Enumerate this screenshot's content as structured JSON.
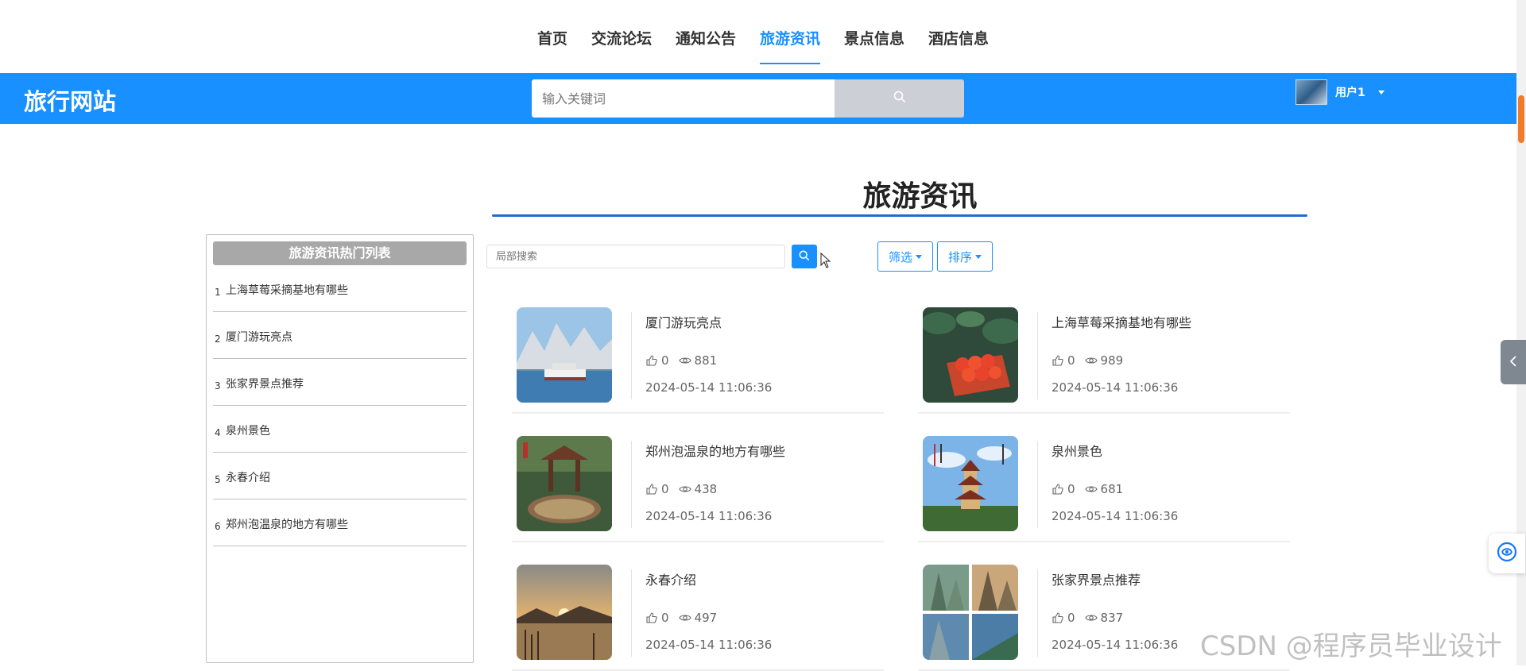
{
  "nav": {
    "items": [
      {
        "label": "首页",
        "active": false
      },
      {
        "label": "交流论坛",
        "active": false
      },
      {
        "label": "通知公告",
        "active": false
      },
      {
        "label": "旅游资讯",
        "active": true
      },
      {
        "label": "景点信息",
        "active": false
      },
      {
        "label": "酒店信息",
        "active": false
      }
    ]
  },
  "header": {
    "brand": "旅行网站",
    "search_placeholder": "输入关键词",
    "user_name": "用户1",
    "accent_color": "#1890ff"
  },
  "page": {
    "title": "旅游资讯"
  },
  "hot": {
    "title": "旅游资讯热门列表",
    "items": [
      {
        "num": "1",
        "label": "上海草莓采摘基地有哪些"
      },
      {
        "num": "2",
        "label": "厦门游玩亮点"
      },
      {
        "num": "3",
        "label": "张家界景点推荐"
      },
      {
        "num": "4",
        "label": "泉州景色"
      },
      {
        "num": "5",
        "label": "永春介绍"
      },
      {
        "num": "6",
        "label": "郑州泡温泉的地方有哪些"
      }
    ]
  },
  "toolbar": {
    "local_search_placeholder": "局部搜索",
    "filter_label": "筛选",
    "sort_label": "排序"
  },
  "articles": [
    {
      "title": "厦门游玩亮点",
      "likes": "0",
      "views": "881",
      "date": "2024-05-14 11:06:36",
      "thumb": "boat-mountain"
    },
    {
      "title": "上海草莓采摘基地有哪些",
      "likes": "0",
      "views": "989",
      "date": "2024-05-14 11:06:36",
      "thumb": "strawberries"
    },
    {
      "title": "郑州泡温泉的地方有哪些",
      "likes": "0",
      "views": "438",
      "date": "2024-05-14 11:06:36",
      "thumb": "hot-spring"
    },
    {
      "title": "泉州景色",
      "likes": "0",
      "views": "681",
      "date": "2024-05-14 11:06:36",
      "thumb": "pagoda"
    },
    {
      "title": "永春介绍",
      "likes": "0",
      "views": "497",
      "date": "2024-05-14 11:06:36",
      "thumb": "sunset-lake"
    },
    {
      "title": "张家界景点推荐",
      "likes": "0",
      "views": "837",
      "date": "2024-05-14 11:06:36",
      "thumb": "mountains-collage"
    }
  ],
  "watermark": "CSDN @程序员毕业设计"
}
